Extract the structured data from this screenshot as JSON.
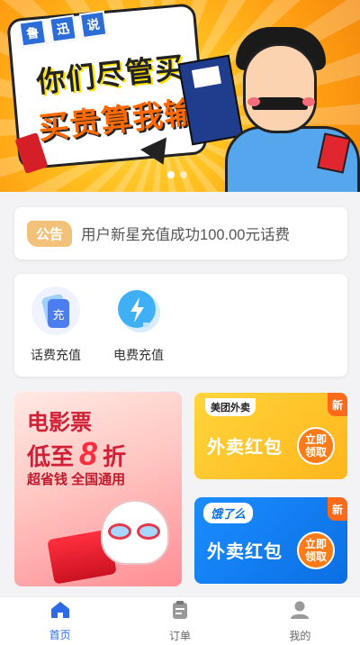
{
  "banner": {
    "tags": [
      "鲁",
      "迅",
      "说"
    ],
    "slogan_line1": "你们尽管买",
    "slogan_line2": "买贵算我输"
  },
  "notice": {
    "tag": "公告",
    "text": "用户新星充值成功100.00元话费"
  },
  "services": [
    {
      "label": "话费充值",
      "icon": "phone-recharge-icon",
      "glyph": "充"
    },
    {
      "label": "电费充值",
      "icon": "lightning-icon"
    }
  ],
  "promos": {
    "movie": {
      "title": "电影票",
      "sub_prefix": "低至",
      "sub_num": "8",
      "sub_suffix": "折",
      "slogan": "超省钱 全国通用"
    },
    "meituan": {
      "brand": "美团外卖",
      "title": "外卖红包",
      "button": "立即领取",
      "badge": "新"
    },
    "eleme": {
      "brand": "饿了么",
      "title": "外卖红包",
      "button": "立即领取",
      "badge": "新"
    }
  },
  "tabbar": [
    {
      "label": "首页",
      "icon": "home-icon",
      "active": true
    },
    {
      "label": "订单",
      "icon": "order-clipboard-icon",
      "active": false
    },
    {
      "label": "我的",
      "icon": "user-icon",
      "active": false
    }
  ],
  "colors": {
    "accent": "#2d6ae6",
    "notice_tag": "#f2c27a"
  }
}
